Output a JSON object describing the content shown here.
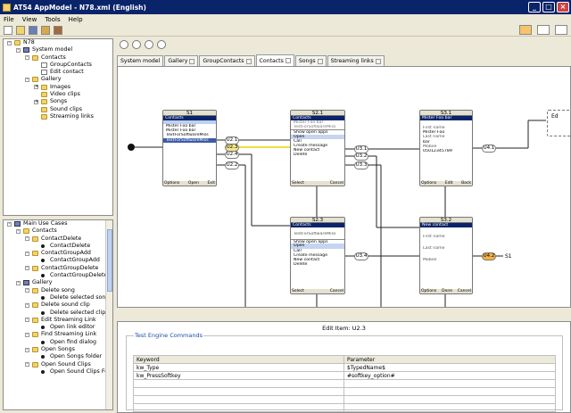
{
  "window": {
    "title": "AT54 AppModel - N78.xml (English)",
    "controls": [
      "_",
      "□",
      "×"
    ]
  },
  "menu": [
    "File",
    "View",
    "Tools",
    "Help"
  ],
  "tree_top": [
    {
      "label": "N78",
      "icon": "folder-icon",
      "level": 0,
      "toggle": "-"
    },
    {
      "label": "System model",
      "icon": "model-icon",
      "level": 1,
      "toggle": "-"
    },
    {
      "label": "Contacts",
      "icon": "folder-icon",
      "level": 2,
      "toggle": "-"
    },
    {
      "label": "GroupContacts",
      "icon": "doc-icon",
      "level": 3,
      "toggle": ""
    },
    {
      "label": "Edit contact",
      "icon": "doc-icon",
      "level": 3,
      "toggle": ""
    },
    {
      "label": "Gallery",
      "icon": "folder-icon",
      "level": 2,
      "toggle": "-"
    },
    {
      "label": "Images",
      "icon": "folder-icon",
      "level": 3,
      "toggle": "+"
    },
    {
      "label": "Video clips",
      "icon": "folder-icon",
      "level": 3,
      "toggle": ""
    },
    {
      "label": "Songs",
      "icon": "folder-icon",
      "level": 3,
      "toggle": "+"
    },
    {
      "label": "Sound clips",
      "icon": "folder-icon",
      "level": 3,
      "toggle": ""
    },
    {
      "label": "Streaming links",
      "icon": "folder-icon",
      "level": 3,
      "toggle": ""
    }
  ],
  "tree_bottom": [
    {
      "label": "Main Use Cases",
      "icon": "model-icon",
      "level": 0,
      "toggle": "-"
    },
    {
      "label": "Contacts",
      "icon": "folder-icon",
      "level": 1,
      "toggle": "-"
    },
    {
      "label": "ContactDelete",
      "icon": "folder-icon",
      "level": 2,
      "toggle": "-"
    },
    {
      "label": "ContactDelete",
      "icon": "dot-icon",
      "level": 3,
      "toggle": ""
    },
    {
      "label": "ContactGroupAdd",
      "icon": "folder-icon",
      "level": 2,
      "toggle": "-"
    },
    {
      "label": "ContactGroupAdd",
      "icon": "dot-icon",
      "level": 3,
      "toggle": ""
    },
    {
      "label": "ContactGroupDelete",
      "icon": "folder-icon",
      "level": 2,
      "toggle": "-"
    },
    {
      "label": "ContactGroupDelete",
      "icon": "dot-icon",
      "level": 3,
      "toggle": ""
    },
    {
      "label": "Gallery",
      "icon": "model-icon",
      "level": 1,
      "toggle": "-"
    },
    {
      "label": "Delete song",
      "icon": "folder-icon",
      "level": 2,
      "toggle": "-"
    },
    {
      "label": "Delete selected song",
      "icon": "dot-icon",
      "level": 3,
      "toggle": ""
    },
    {
      "label": "Delete sound clip",
      "icon": "folder-icon",
      "level": 2,
      "toggle": "-"
    },
    {
      "label": "Delete selected clip",
      "icon": "dot-icon",
      "level": 3,
      "toggle": ""
    },
    {
      "label": "Edit Streaming Link",
      "icon": "folder-icon",
      "level": 2,
      "toggle": "-"
    },
    {
      "label": "Open link editor",
      "icon": "dot-icon",
      "level": 3,
      "toggle": ""
    },
    {
      "label": "Find Streaming Link",
      "icon": "folder-icon",
      "level": 2,
      "toggle": "-"
    },
    {
      "label": "Open find dialog",
      "icon": "dot-icon",
      "level": 3,
      "toggle": ""
    },
    {
      "label": "Open Songs",
      "icon": "folder-icon",
      "level": 2,
      "toggle": "-"
    },
    {
      "label": "Open Songs folder",
      "icon": "dot-icon",
      "level": 3,
      "toggle": ""
    },
    {
      "label": "Open Sound Clips",
      "icon": "folder-icon",
      "level": 2,
      "toggle": "-"
    },
    {
      "label": "Open Sound Clips Folde",
      "icon": "dot-icon",
      "level": 3,
      "toggle": ""
    }
  ],
  "tabs": [
    {
      "label": "System model",
      "active": false,
      "closable": false
    },
    {
      "label": "Gallery",
      "active": false,
      "closable": true
    },
    {
      "label": "GroupContacts",
      "active": false,
      "closable": true
    },
    {
      "label": "Contacts",
      "active": true,
      "closable": true
    },
    {
      "label": "Songs",
      "active": false,
      "closable": true
    },
    {
      "label": "Streaming links",
      "active": false,
      "closable": true
    }
  ],
  "states": {
    "s1": {
      "title": "S1",
      "header": "Contacts",
      "lines": [
        "Mister Foo bar",
        "Mister Foo bar",
        "TextForSoftwareMiss",
        "TextForSoftwareMiss"
      ],
      "footer_left": "Options",
      "footer_mid": "Open",
      "footer_right": "Exit"
    },
    "s21": {
      "title": "S2.1",
      "header": "Contacts",
      "lines": [
        "Mister Foo bar",
        "TestForSoftwareMiss",
        "Show open apps",
        "Open",
        "Call",
        "Create message",
        "New contact",
        "Delete"
      ],
      "footer_left": "Select",
      "footer_right": "Cancel"
    },
    "s31": {
      "title": "S3.1",
      "header": "Mister Foo bar",
      "lines": [
        "First name",
        "Mister Foo",
        "Last name",
        "bar",
        "Mobile",
        "05012345789"
      ],
      "footer_left": "Options",
      "footer_mid": "Edit",
      "footer_right": "Back"
    },
    "s23": {
      "title": "S2.3",
      "header": "Contacts",
      "lines": [
        "TestForSoftwareMiss",
        "Show open apps",
        "Open",
        "Call",
        "Create message",
        "New contact",
        "Delete"
      ],
      "footer_left": "Select",
      "footer_right": "Cancel"
    },
    "s32": {
      "title": "S3.2",
      "header": "New contact",
      "lines": [
        "First name",
        "Last name",
        "Mobile"
      ],
      "footer_left": "Options",
      "footer_mid": "Done",
      "footer_right": "Cancel"
    },
    "ed": {
      "title": "Ed"
    }
  },
  "transitions": [
    "U2.1",
    "U2.3",
    "U2.4",
    "U2.2",
    "U3.1",
    "U3.2",
    "U3.3",
    "U3.4",
    "U4.1",
    "U4.2",
    "S1"
  ],
  "properties": {
    "title": "Edit Item: U2.3",
    "group_label": "Test Engine Commands",
    "columns": [
      "Keyword",
      "Parameter"
    ],
    "rows": [
      [
        "kw_Type",
        "$TypedName$"
      ],
      [
        "kw_PressSoftkey",
        "#softkey_option#"
      ],
      [
        "",
        ""
      ],
      [
        "",
        ""
      ],
      [
        "",
        ""
      ],
      [
        "",
        ""
      ]
    ]
  }
}
